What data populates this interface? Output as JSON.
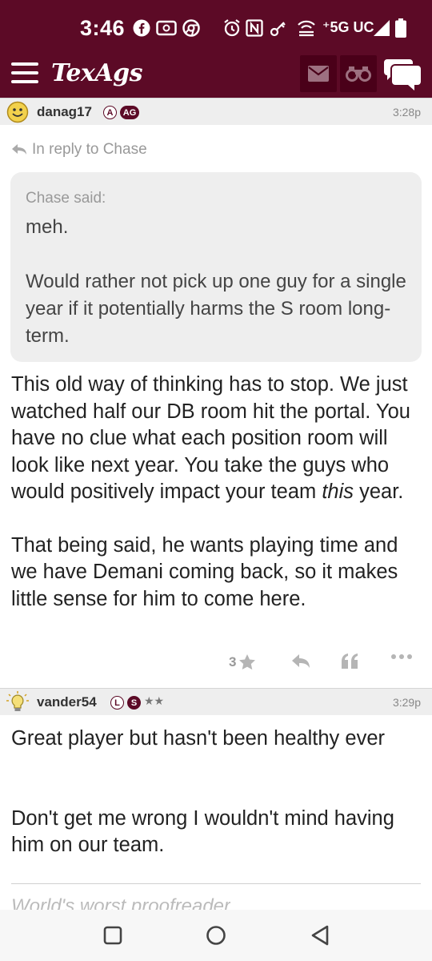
{
  "status_bar": {
    "time": "3:46",
    "network": "5G UC",
    "icons": [
      "facebook-icon",
      "radio-icon",
      "chrome-icon",
      "alarm-icon",
      "nfc-icon",
      "key-icon",
      "hotspot-icon",
      "signal-icon",
      "battery-icon"
    ]
  },
  "header": {
    "logo": "TexAgs",
    "icons": [
      "menu-icon",
      "mail-icon",
      "binoculars-icon",
      "chat-icon"
    ]
  },
  "posts": [
    {
      "username": "danag17",
      "badges": [
        "A",
        "AG"
      ],
      "time": "3:28p",
      "reply_to": "In reply to Chase",
      "quote": {
        "author": "Chase said:",
        "text": "meh.\n\nWould rather not pick up one guy for a single year if it potentially harms the S room long-term."
      },
      "body_part1": "This old way of thinking has to stop. We just watched half our DB room hit the portal. You have no clue what each position room will look like next year. You take the guys who would positively impact your team ",
      "body_emphasis": "this",
      "body_part2": " year.",
      "body_para2": "That being said, he wants playing time and we have Demani coming back, so it makes little sense for him to come here.",
      "star_count": "3"
    },
    {
      "username": "vander54",
      "badges": [
        "L",
        "S"
      ],
      "stars": "★★",
      "time": "3:29p",
      "body_para1": "Great player but hasn't been healthy ever",
      "body_para2": "Don't get me wrong I wouldn't mind having him on our team.",
      "signature": "World's worst proofreader"
    }
  ],
  "colors": {
    "brand": "#5c0a26",
    "header_button": "#4a0019"
  },
  "nav": {
    "icons": [
      "recents-icon",
      "home-icon",
      "back-icon"
    ]
  }
}
